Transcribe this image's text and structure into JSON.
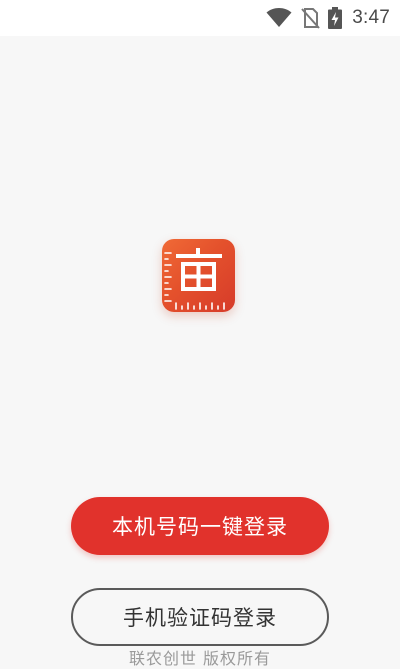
{
  "status_bar": {
    "time": "3:47",
    "icons": [
      "wifi-icon",
      "no-sim-icon",
      "battery-charging-icon"
    ]
  },
  "logo": {
    "icon": "app-logo-icon",
    "color": "#e4512c"
  },
  "buttons": {
    "one_click_login": "本机号码一键登录",
    "sms_code_login": "手机验证码登录"
  },
  "footer": {
    "copyright": "联农创世 版权所有"
  },
  "colors": {
    "primary": "#e1322c",
    "background": "#f7f7f7"
  }
}
